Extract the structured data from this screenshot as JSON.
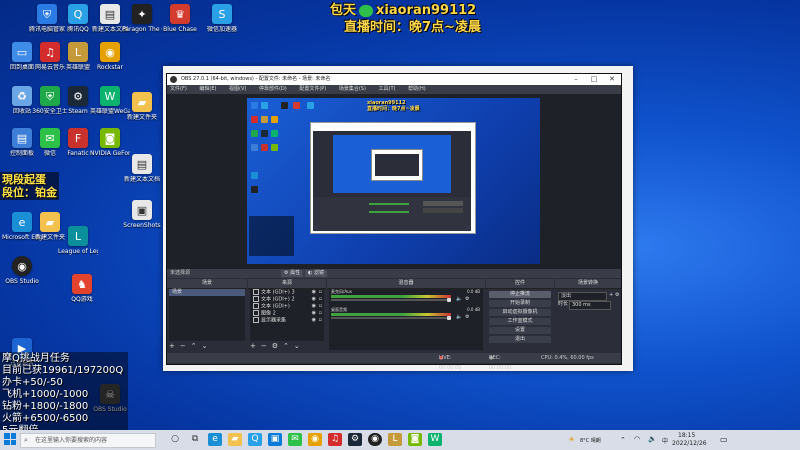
{
  "overlay": {
    "top_line1_left": "包天",
    "top_line1_right": "xiaoran99112",
    "top_line2": "直播时间：晚7点~凌晨",
    "tier_line1": "現段起蛋",
    "tier_line2": "段位：铂金",
    "tasks": [
      "摩Q挑战月任务",
      "目前已获19961/197200Q",
      "办卡+50/-50",
      "飞机+1000/-1000",
      "钻粉+1800/-1800",
      "火箭+6500/-6500",
      "5元翻倍"
    ]
  },
  "desktop_icons": [
    {
      "label": "腾讯电脑管家",
      "icon": "shield-icon",
      "color": "#2a7be4"
    },
    {
      "label": "回到桌面",
      "icon": "monitor-icon",
      "color": "#3f8ce8"
    },
    {
      "label": "回收站",
      "icon": "recycle-icon",
      "color": "#6aa6e6"
    },
    {
      "label": "控制面板",
      "icon": "panel-icon",
      "color": "#3d7fd8"
    },
    {
      "label": "Microsoft Edge",
      "icon": "edge-icon",
      "color": "#1a8fd6"
    },
    {
      "label": "OBS Studio",
      "icon": "obs-icon",
      "color": "#222222"
    },
    {
      "label": "迅雷影音",
      "icon": "video-icon",
      "color": "#1c64d1"
    },
    {
      "label": "网易云音乐",
      "icon": "music-icon",
      "color": "#d32c2c"
    },
    {
      "label": "360安全卫士",
      "icon": "shield-icon",
      "color": "#1fa84a"
    },
    {
      "label": "微信",
      "icon": "wechat-icon",
      "color": "#2ec14a"
    },
    {
      "label": "英雄联盟",
      "icon": "lol-icon",
      "color": "#c59a3a"
    },
    {
      "label": "Rockstar",
      "icon": "app-icon",
      "color": "#e5a100"
    },
    {
      "label": "Steam",
      "icon": "steam-icon",
      "color": "#1b2838"
    },
    {
      "label": "Fanatic",
      "icon": "app-icon",
      "color": "#c9312c"
    },
    {
      "label": "League of Legends",
      "icon": "lol-icon",
      "color": "#0a8f9b"
    },
    {
      "label": "QQ游戏",
      "icon": "qq-icon",
      "color": "#e3432d"
    },
    {
      "label": "腾讯QQ",
      "icon": "qq-icon",
      "color": "#2aa0e6"
    },
    {
      "label": "英雄联盟WeGame",
      "icon": "wegame-icon",
      "color": "#0bb36e"
    },
    {
      "label": "NVIDIA GeForce Experience",
      "icon": "nvidia-icon",
      "color": "#76b900"
    },
    {
      "label": "Paragon The Outcome",
      "icon": "game-icon",
      "color": "#222222"
    },
    {
      "label": "新建文本文档",
      "icon": "doc-icon",
      "color": "#e8e8e8"
    },
    {
      "label": "Blue Chase",
      "icon": "game-icon",
      "color": "#d33b2e"
    },
    {
      "label": "新建文件夹",
      "icon": "folder-icon",
      "color": "#f2c14e"
    },
    {
      "label": "ScreenShots",
      "icon": "image-icon",
      "color": "#e8e8e8"
    },
    {
      "label": "微信加速器",
      "icon": "speed-icon",
      "color": "#2aa0e6"
    }
  ],
  "obs": {
    "title": "OBS 27.0.1 (64-bit, windows) - 配置文件: 未命名 - 场景: 未命名",
    "menu": [
      "文件(F)",
      "编辑(E)",
      "视图(V)",
      "停靠部件(D)",
      "配置文件(P)",
      "场景集合(S)",
      "工具(T)",
      "帮助(H)"
    ],
    "no_source": "未选择源",
    "properties": "属性",
    "filters": "滤镜",
    "docks": {
      "scenes": "场景",
      "sources": "来源",
      "mixer": "混音器",
      "controls": "控件",
      "transitions": "场景转换"
    },
    "scene_items": [
      "场景"
    ],
    "source_items": [
      "文本 (GDI+) 3",
      "文本 (GDI+) 2",
      "文本 (GDI+)",
      "图像 2",
      "显示器采集"
    ],
    "mixer_tracks": [
      {
        "name": "麦克风/Aux",
        "db": "0.0 dB"
      },
      {
        "name": "桌面音频",
        "db": "0.0 dB"
      }
    ],
    "controls": [
      "停止推流",
      "开始录制",
      "启动虚拟摄像机",
      "工作室模式",
      "设置",
      "退出"
    ],
    "transition_name": "淡出",
    "duration_label": "时长",
    "duration_value": "300 ms",
    "status": {
      "live": "LIVE: 00:00:00",
      "rec": "REC: 00:00:00",
      "cpu": "CPU: 0.4%, 60.00 fps"
    }
  },
  "taskbar": {
    "search_placeholder": "在这里输入你要搜索的内容",
    "weather": "8°C 晴朗",
    "lang": "中",
    "time": "18:15",
    "date": "2022/12/26"
  }
}
